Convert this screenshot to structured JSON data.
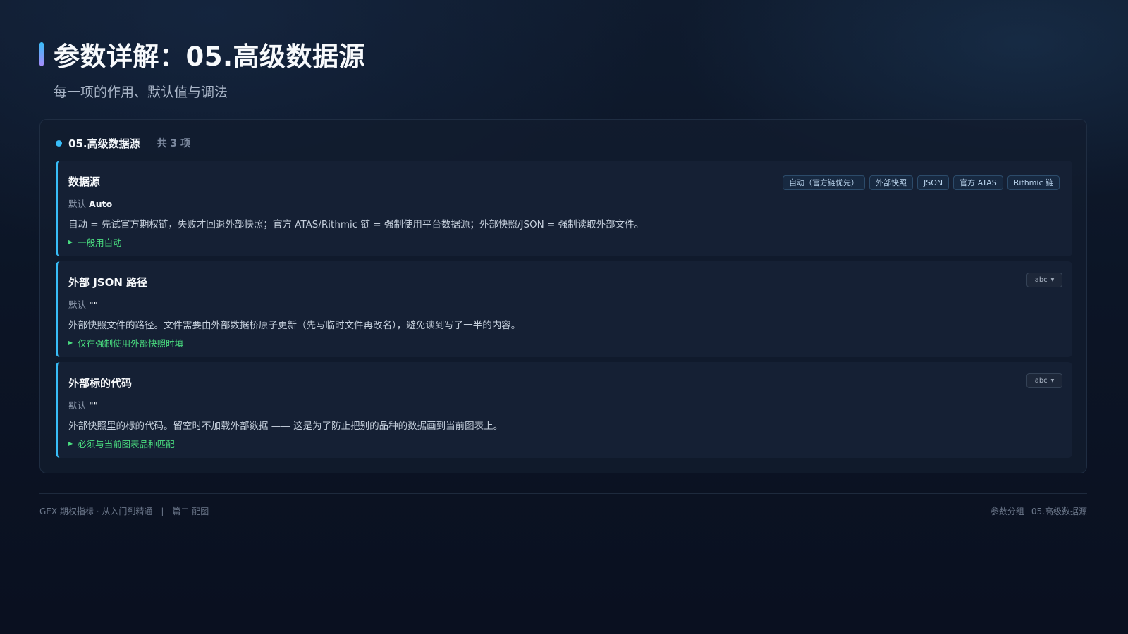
{
  "header": {
    "title": "参数详解：05.高级数据源",
    "subtitle": "每一项的作用、默认值与调法"
  },
  "section": {
    "name": "05.高级数据源",
    "count": "共 3 项",
    "accent_color": "#38bdf8"
  },
  "items": [
    {
      "name": "数据源",
      "default_label": "默认",
      "default_value": "Auto",
      "description": "自动 = 先试官方期权链，失败才回退外部快照；官方 ATAS/Rithmic 链 = 强制使用平台数据源；外部快照/JSON = 强制读取外部文件。",
      "tip": "一般用自动",
      "options": [
        "自动（官方链优先）",
        "外部快照",
        "JSON",
        "官方 ATAS",
        "Rithmic 链"
      ]
    },
    {
      "name": "外部 JSON 路径",
      "default_label": "默认",
      "default_value": "\"\"",
      "description": "外部快照文件的路径。文件需要由外部数据桥原子更新（先写临时文件再改名），避免读到写了一半的内容。",
      "tip": "仅在强制使用外部快照时填",
      "type": "abc"
    },
    {
      "name": "外部标的代码",
      "default_label": "默认",
      "default_value": "\"\"",
      "description": "外部快照里的标的代码。留空时不加载外部数据 —— 这是为了防止把别的品种的数据画到当前图表上。",
      "tip": "必须与当前图表品种匹配",
      "type": "abc"
    }
  ],
  "footer": {
    "left_main": "GEX 期权指标 · 从入门到精通",
    "separator": "|",
    "left_sub": "篇二 配图",
    "right_group": "参数分组",
    "right_section": "05.高级数据源"
  },
  "colors": {
    "accent": "#38bdf8",
    "tip_green": "#4ade80",
    "background": "#0b1120"
  }
}
